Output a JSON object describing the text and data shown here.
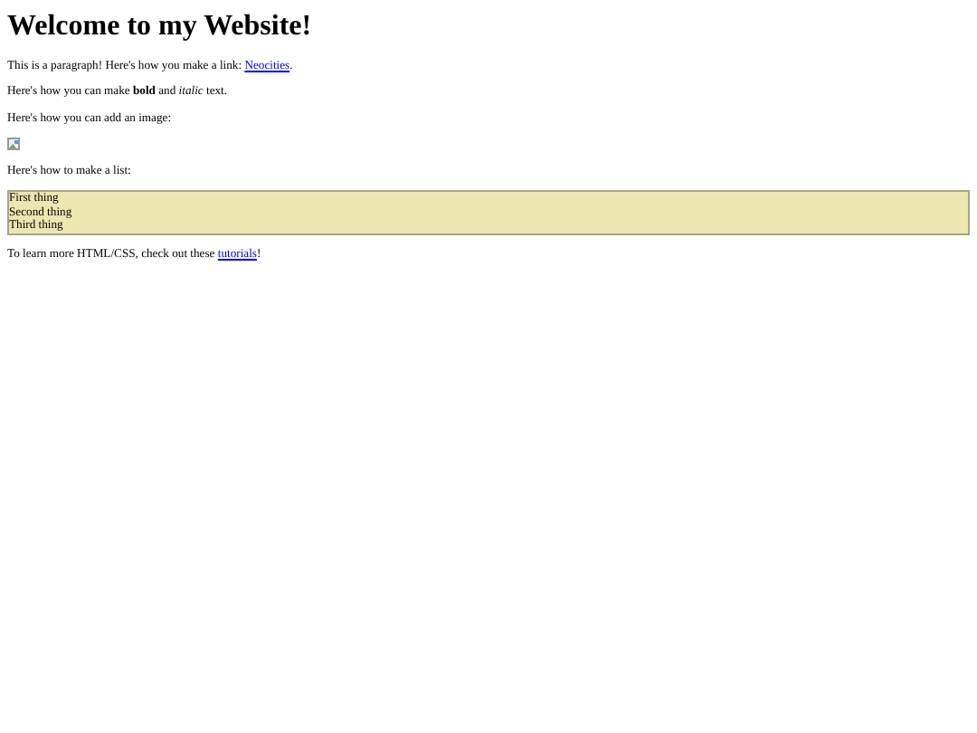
{
  "heading": "Welcome to my Website!",
  "blocks": [
    {
      "kind": "link_paragraph",
      "before": "This is a paragraph! Here's how you make a link: ",
      "link": "Neocities",
      "after": "."
    },
    {
      "kind": "paragraph",
      "text": "Here's how you can make **bold** and *italic* text."
    },
    {
      "kind": "paragraph",
      "text": "Here's how you can add an image:"
    },
    {
      "kind": "broken_image"
    },
    {
      "kind": "paragraph",
      "text": "Here's how to make a list:"
    },
    {
      "kind": "list",
      "items": [
        "First thing",
        "Second thing",
        "Third thing"
      ]
    },
    {
      "kind": "link_paragraph",
      "before": "To learn more HTML/CSS, check out these ",
      "link": "tutorials",
      "after": "!"
    }
  ]
}
